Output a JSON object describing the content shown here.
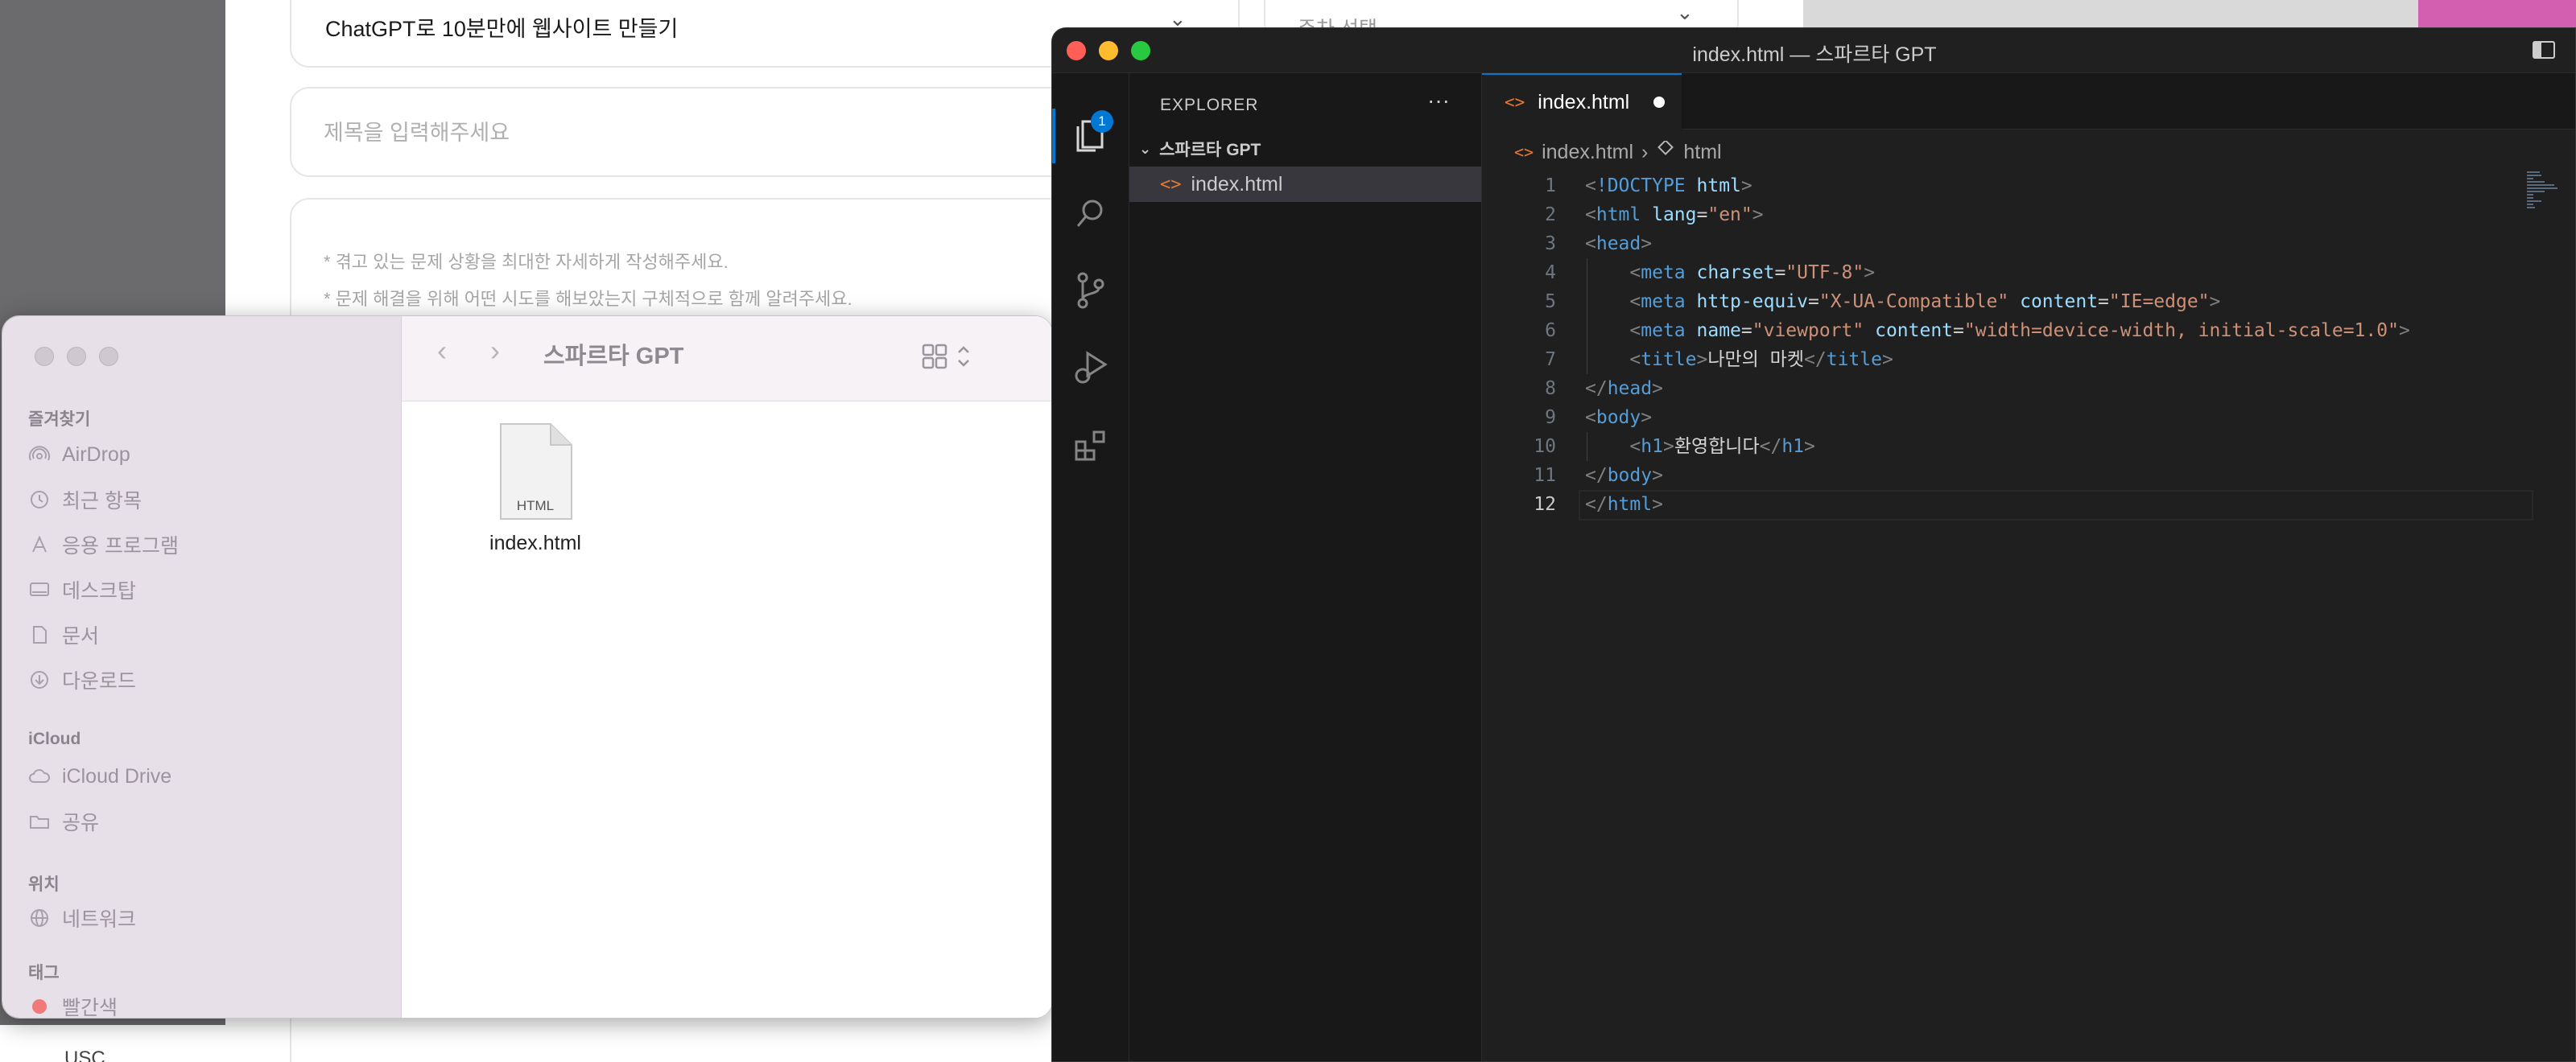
{
  "webpage": {
    "category_value": "ChatGPT로 10분만에 웹사이트 만들기",
    "sort_value": "주차 선택",
    "title_placeholder": "제목을 입력해주세요",
    "hint1": "* 겪고 있는 문제 상황을 최대한 자세하게 작성해주세요.",
    "hint2": "* 문제 해결을 위해 어떤 시도를 해보았는지 구체적으로 함께 알려주세요.",
    "bottom_text": "USC..."
  },
  "finder": {
    "title": "스파르타 GPT",
    "sidebar": {
      "favorites_label": "즐겨찾기",
      "favorites": [
        "AirDrop",
        "최근 항목",
        "응용 프로그램",
        "데스크탑",
        "문서",
        "다운로드"
      ],
      "icloud_label": "iCloud",
      "icloud": [
        "iCloud Drive",
        "공유"
      ],
      "locations_label": "위치",
      "locations": [
        "네트워크"
      ],
      "tags_label": "태그",
      "tags": [
        "빨간색"
      ]
    },
    "file": {
      "name": "index.html",
      "badge": "HTML"
    }
  },
  "vscode": {
    "window_title": "index.html — 스파르타 GPT",
    "badge_count": "1",
    "explorer": {
      "title": "EXPLORER",
      "folder": "스파르타 GPT",
      "file": "index.html"
    },
    "tab": {
      "label": "index.html"
    },
    "breadcrumb": {
      "file": "index.html",
      "symbol": "html"
    },
    "line_numbers": [
      "1",
      "2",
      "3",
      "4",
      "5",
      "6",
      "7",
      "8",
      "9",
      "10",
      "11",
      "12"
    ],
    "active_line": "12",
    "code": {
      "l1_doctype": "!DOCTYPE",
      "l1_html": "html",
      "tag_html": "html",
      "attr_lang": "lang",
      "val_lang": "\"en\"",
      "tag_head": "head",
      "tag_meta": "meta",
      "attr_charset": "charset",
      "val_charset": "\"UTF-8\"",
      "attr_http_equiv": "http-equiv",
      "val_http_equiv": "\"X-UA-Compatible\"",
      "attr_content": "content",
      "val_content_ie": "\"IE=edge\"",
      "attr_name": "name",
      "val_viewport": "\"viewport\"",
      "val_content_vp": "\"width=device-width, initial-scale=1.0\"",
      "tag_title": "title",
      "title_text": "나만의 마켓",
      "tag_body": "body",
      "tag_h1": "h1",
      "h1_text": "환영합니다"
    }
  },
  "colors": {
    "accent": "#0078d4",
    "close": "#ff5f57",
    "minimize": "#febc2e",
    "maximize": "#28c840"
  }
}
